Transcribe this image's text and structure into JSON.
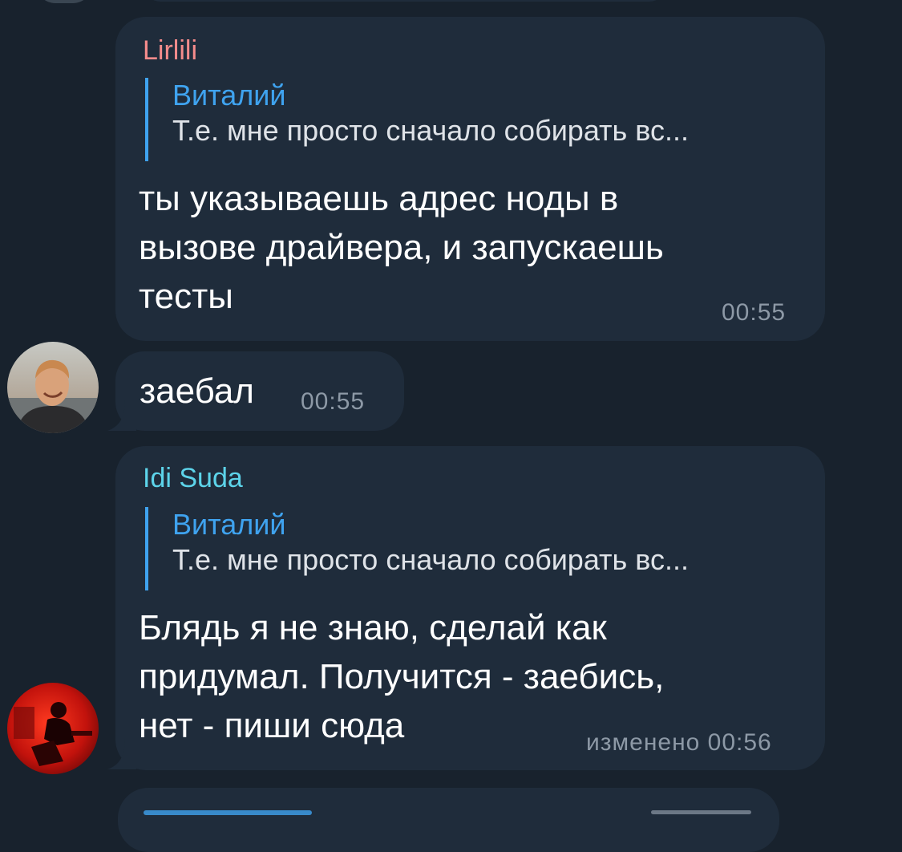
{
  "messages": [
    {
      "sender": "Lirlili",
      "sender_color": "#f58c8c",
      "reply": {
        "name": "Виталий",
        "text": "Т.е. мне просто сначало собирать вс..."
      },
      "lines": [
        "ты указываешь адрес ноды в",
        "вызове драйвера, и запускаешь",
        "тесты"
      ],
      "time": "00:55"
    },
    {
      "text": "заебал",
      "time": "00:55"
    },
    {
      "sender": "Idi Suda",
      "sender_color": "#5dd4ea",
      "reply": {
        "name": "Виталий",
        "text": "Т.е. мне просто сначало собирать вс..."
      },
      "lines": [
        "Блядь я не знаю, сделай как",
        "придумал. Получится - заебись,",
        "нет - пиши сюда"
      ],
      "time": "изменено 00:56"
    }
  ],
  "colors": {
    "background": "#18222d",
    "bubble": "#1f2c3b",
    "reply_accent": "#3fa3ef",
    "time": "#8d99a6"
  },
  "icons": [
    "avatar-photo-1",
    "avatar-photo-2"
  ]
}
